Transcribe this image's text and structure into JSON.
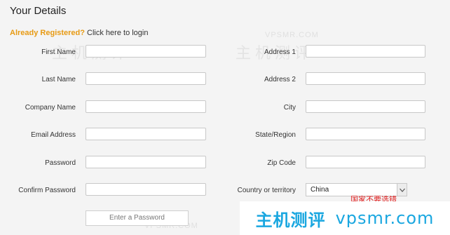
{
  "header": {
    "title": "Your Details"
  },
  "login": {
    "question": "Already Registered?",
    "link": "Click here to login"
  },
  "left_fields": [
    {
      "label": "First Name"
    },
    {
      "label": "Last Name"
    },
    {
      "label": "Company Name"
    },
    {
      "label": "Email Address"
    },
    {
      "label": "Password"
    },
    {
      "label": "Confirm Password"
    }
  ],
  "right_fields": [
    {
      "label": "Address 1"
    },
    {
      "label": "Address 2"
    },
    {
      "label": "City"
    },
    {
      "label": "State/Region"
    },
    {
      "label": "Zip Code"
    },
    {
      "label": "Country or territory"
    }
  ],
  "country": {
    "selected": "China",
    "note": "国家不要选错"
  },
  "password_button": {
    "label": "Enter a Password"
  },
  "watermark": {
    "en": "VPSMR.COM",
    "cn": "主机测评"
  },
  "banner": {
    "cn": "主机测评",
    "en": "vpsmr.com"
  },
  "colors": {
    "accent": "#e79a13",
    "note": "#e02020",
    "banner": "#1aa7e0"
  },
  "icons": {
    "select_arrow": "chevron-down-icon"
  }
}
